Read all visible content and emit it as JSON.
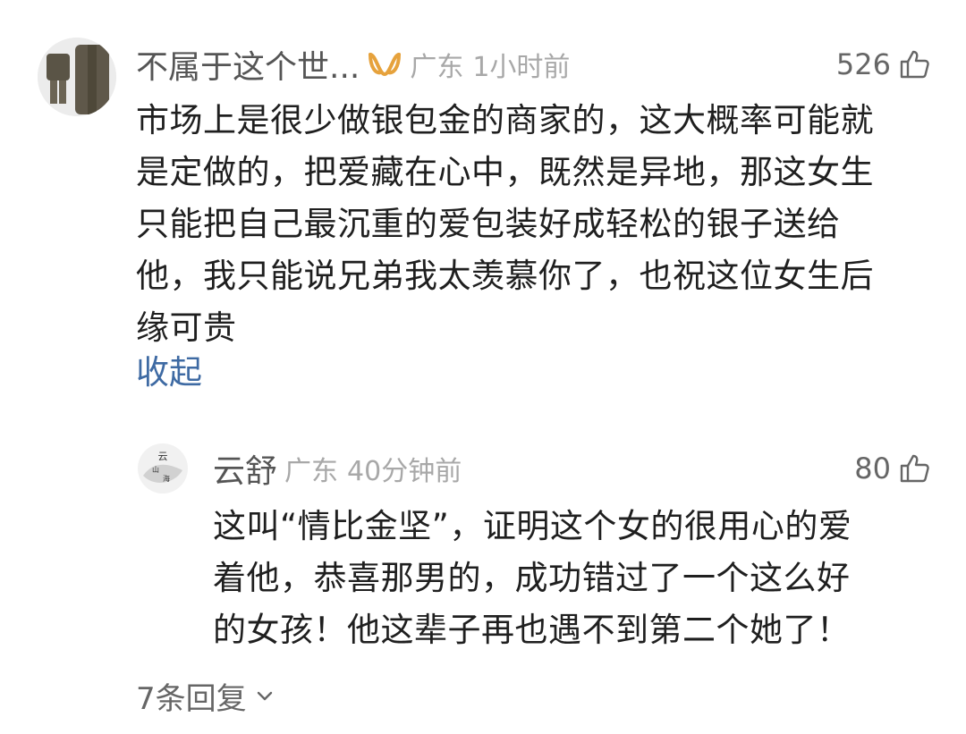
{
  "comment": {
    "username": "不属于这个世...",
    "badge_icon": "vip-badge-icon",
    "location": "广东",
    "time": "1小时前",
    "likes": "526",
    "like_icon": "thumbs-up-icon",
    "content_lines": [
      "市场上是很少做银包金的商家的，这大概率可能就",
      "是定做的，把爱藏在心中，既然是异地，那这女生",
      "只能把自己最沉重的爱包装好成轻松的银子送给",
      "他，我只能说兄弟我太羡慕你了，也祝这位女生后",
      "缘可贵"
    ],
    "collapse_label": "收起"
  },
  "reply": {
    "username": "云舒",
    "avatar_text": "云山海",
    "location": "广东",
    "time": "40分钟前",
    "likes": "80",
    "content_lines": [
      "这叫“情比金坚”，证明这个女的很用心的爱",
      "着他，恭喜那男的，成功错过了一个这么好",
      "的女孩！他这辈子再也遇不到第二个她了！"
    ]
  },
  "replies_toggle": {
    "label": "7条回复",
    "icon": "chevron-down-icon"
  },
  "colors": {
    "link": "#3e6aa3",
    "badge": "#e6a23c",
    "meta": "#a8a8a8"
  }
}
